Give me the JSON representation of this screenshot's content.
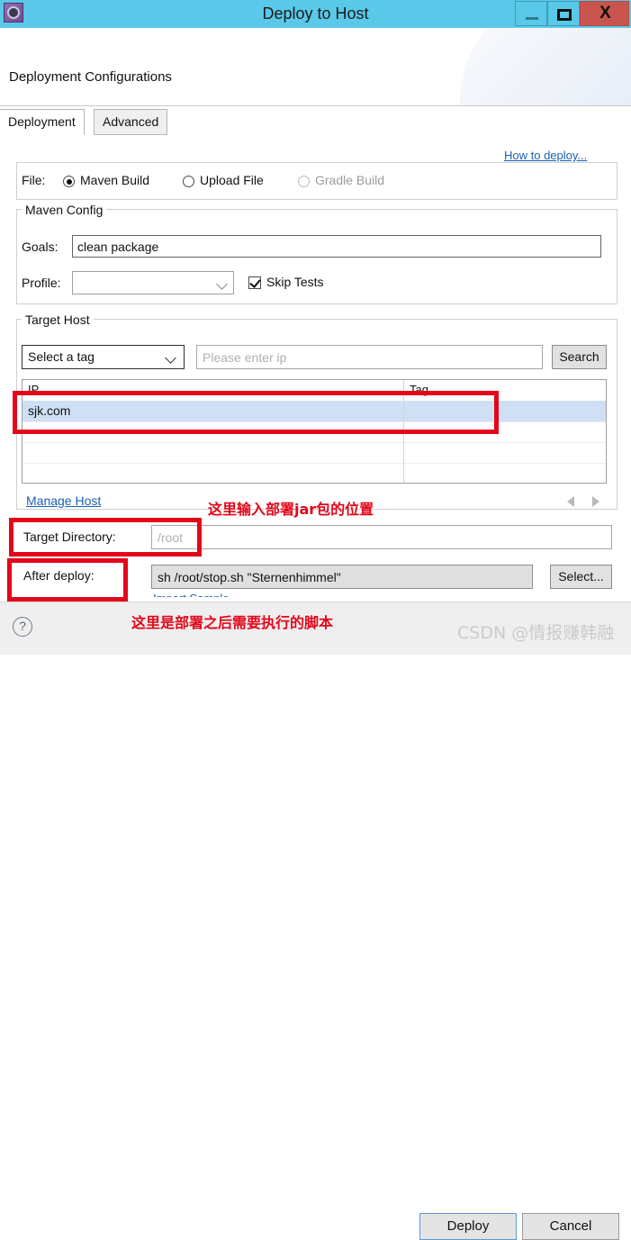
{
  "window": {
    "title": "Deploy to Host",
    "app_icon": "gear-icon",
    "controls": {
      "minimize": "–",
      "maximize": "□",
      "close": "X"
    }
  },
  "header": {
    "title": "Deployment Configurations"
  },
  "tabs": [
    {
      "label": "Deployment",
      "active": true
    },
    {
      "label": "Advanced",
      "active": false
    }
  ],
  "links": {
    "how_to_deploy": "How to deploy...",
    "manage_host": "Manage Host",
    "clipped_link": "Import Sample"
  },
  "file_group": {
    "label": "File:",
    "options": [
      {
        "label": "Maven Build",
        "checked": true,
        "disabled": false
      },
      {
        "label": "Upload File",
        "checked": false,
        "disabled": false
      },
      {
        "label": "Gradle Build",
        "checked": false,
        "disabled": true
      }
    ]
  },
  "maven_config": {
    "legend": "Maven Config",
    "goals_label": "Goals:",
    "goals_value": "clean package",
    "profile_label": "Profile:",
    "profile_value": "",
    "skip_tests_label": "Skip Tests",
    "skip_tests_checked": true
  },
  "target_host": {
    "legend": "Target Host",
    "tag_select_value": "Select a tag",
    "ip_placeholder": "Please enter ip",
    "ip_value": "",
    "search_label": "Search",
    "table": {
      "columns": [
        "IP",
        "Tag"
      ],
      "rows": [
        {
          "ip": "sjk.com",
          "tag": "",
          "selected": true
        },
        {
          "ip": "",
          "tag": "",
          "selected": false
        },
        {
          "ip": "",
          "tag": "",
          "selected": false
        },
        {
          "ip": "",
          "tag": "",
          "selected": false
        }
      ]
    },
    "pager": {
      "prev": "left-arrow-icon",
      "next": "right-arrow-icon"
    }
  },
  "deploy_settings": {
    "target_directory_label": "Target Directory:",
    "target_directory_placeholder": "/root",
    "target_directory_value": "",
    "after_deploy_label": "After deploy:",
    "after_deploy_value": "sh /root/stop.sh \"Sternenhimmel\"",
    "select_label": "Select..."
  },
  "footer": {
    "help": "?",
    "deploy_label": "Deploy",
    "cancel_label": "Cancel"
  },
  "annotations": {
    "note_target_directory": "这里输入部署jar包的位置",
    "note_after_deploy": "这里是部署之后需要执行的脚本"
  },
  "watermark": "CSDN @情报赚韩融",
  "colors": {
    "titlebar": "#5ac8e8",
    "close_button": "#c9564e",
    "link": "#1a5fb4",
    "annotation": "#e3061a",
    "selection": "#cfe0f5",
    "focus_border": "#5b9bd5"
  }
}
